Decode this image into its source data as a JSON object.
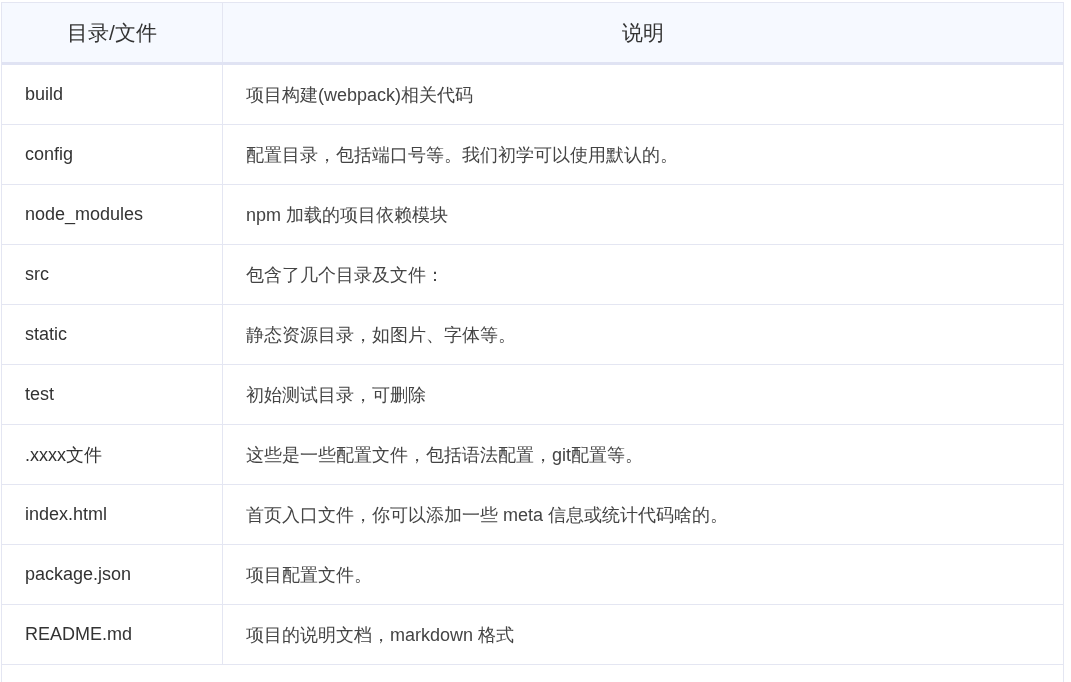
{
  "table": {
    "columns": [
      "目录/文件",
      "说明"
    ],
    "rows": [
      [
        "build",
        "项目构建(webpack)相关代码"
      ],
      [
        "config",
        "配置目录，包括端口号等。我们初学可以使用默认的。"
      ],
      [
        "node_modules",
        "npm 加载的项目依赖模块"
      ],
      [
        "src",
        "包含了几个目录及文件："
      ],
      [
        "static",
        "静态资源目录，如图片、字体等。"
      ],
      [
        "test",
        "初始测试目录，可删除"
      ],
      [
        ".xxxx文件",
        "这些是一些配置文件，包括语法配置，git配置等。"
      ],
      [
        "index.html",
        "首页入口文件，你可以添加一些 meta 信息或统计代码啥的。"
      ],
      [
        "package.json",
        "项目配置文件。"
      ],
      [
        "README.md",
        "项目的说明文档，markdown 格式"
      ]
    ]
  }
}
